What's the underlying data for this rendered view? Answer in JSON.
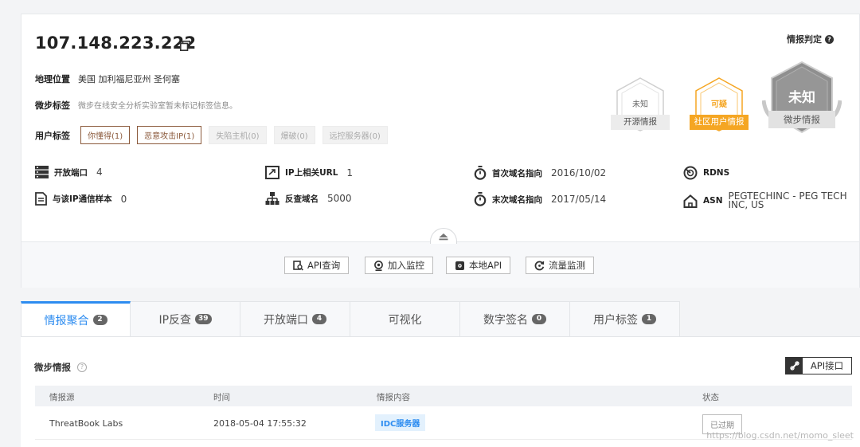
{
  "header": {
    "ip": "107.148.223.222"
  },
  "geo": {
    "label": "地理位置",
    "value": "美国 加利福尼亚州 圣何塞"
  },
  "micro_tags": {
    "label": "微步标签",
    "value": "微步在线安全分析实验室暂未标记标签信息。"
  },
  "user_tags": {
    "label": "用户标签",
    "items": [
      "你懂得(1)",
      "恶意攻击IP(1)",
      "失陷主机(0)",
      "爆破(0)",
      "远控服务器(0)"
    ]
  },
  "verdict": {
    "title": "情报判定",
    "open_source": {
      "level": "未知",
      "label": "开源情报"
    },
    "community": {
      "level": "可疑",
      "label": "社区用户情报"
    },
    "threatbook": {
      "level": "未知",
      "label": "微步情报"
    }
  },
  "stats": {
    "open_ports": {
      "label": "开放端口",
      "value": "4"
    },
    "related_url": {
      "label": "IP上相关URL",
      "value": "1"
    },
    "first_domain": {
      "label": "首次域名指向",
      "value": "2016/10/02"
    },
    "rdns": {
      "label": "RDNS",
      "value": ""
    },
    "samples": {
      "label": "与该IP通信样本",
      "value": "0"
    },
    "reverse_domain": {
      "label": "反查域名",
      "value": "5000"
    },
    "last_domain": {
      "label": "末次域名指向",
      "value": "2017/05/14"
    },
    "asn": {
      "label": "ASN",
      "value": "PEGTECHINC - PEG TECH INC, US"
    }
  },
  "actions": [
    "API查询",
    "加入监控",
    "本地API",
    "流量监测"
  ],
  "tabs": [
    {
      "label": "情报聚合",
      "count": "2"
    },
    {
      "label": "IP反查",
      "count": "39"
    },
    {
      "label": "开放端口",
      "count": "4"
    },
    {
      "label": "可视化",
      "count": ""
    },
    {
      "label": "数字签名",
      "count": "0"
    },
    {
      "label": "用户标签",
      "count": "1"
    }
  ],
  "intel": {
    "title": "微步情报",
    "api_button": "API接口",
    "columns": [
      "情报源",
      "时间",
      "情报内容",
      "状态"
    ],
    "rows": [
      {
        "source": "ThreatBook Labs",
        "time": "2018-05-04 17:55:32",
        "content": "IDC服务器",
        "status": "已过期"
      }
    ]
  },
  "watermark": "https://blog.csdn.net/momo_sleet",
  "colors": {
    "accent": "#2d8cf0",
    "suspicious": "#f5a623",
    "unknown": "#8f8f8f",
    "tag_border": "#8b5a3c"
  }
}
